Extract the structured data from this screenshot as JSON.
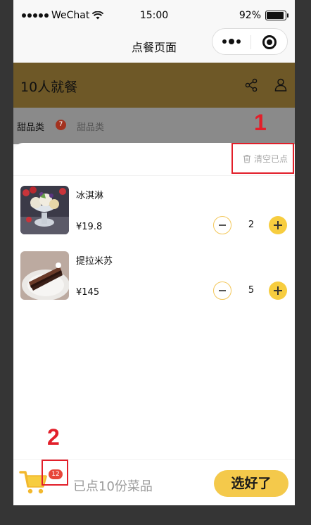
{
  "status_bar": {
    "carrier": "WeChat",
    "time": "15:00",
    "battery": "92%",
    "battery_level": 0.92
  },
  "nav": {
    "title": "点餐页面"
  },
  "header": {
    "title": "10人就餐"
  },
  "categories": [
    {
      "label": "甜品类",
      "badge": "7"
    },
    {
      "label": "甜品类"
    }
  ],
  "annotations": {
    "one": "1",
    "two": "2"
  },
  "cart": {
    "clear_label": "清空已点",
    "items": [
      {
        "name": "冰淇淋",
        "price": "¥19.8",
        "qty": "2"
      },
      {
        "name": "提拉米苏",
        "price": "¥145",
        "qty": "5"
      }
    ]
  },
  "bottom": {
    "badge": "12",
    "summary": "已点10份菜品",
    "confirm_label": "选好了"
  },
  "colors": {
    "accent": "#f4c94b",
    "header": "#6e5827",
    "annotation": "#e21f2a",
    "badge": "#e7463a"
  }
}
